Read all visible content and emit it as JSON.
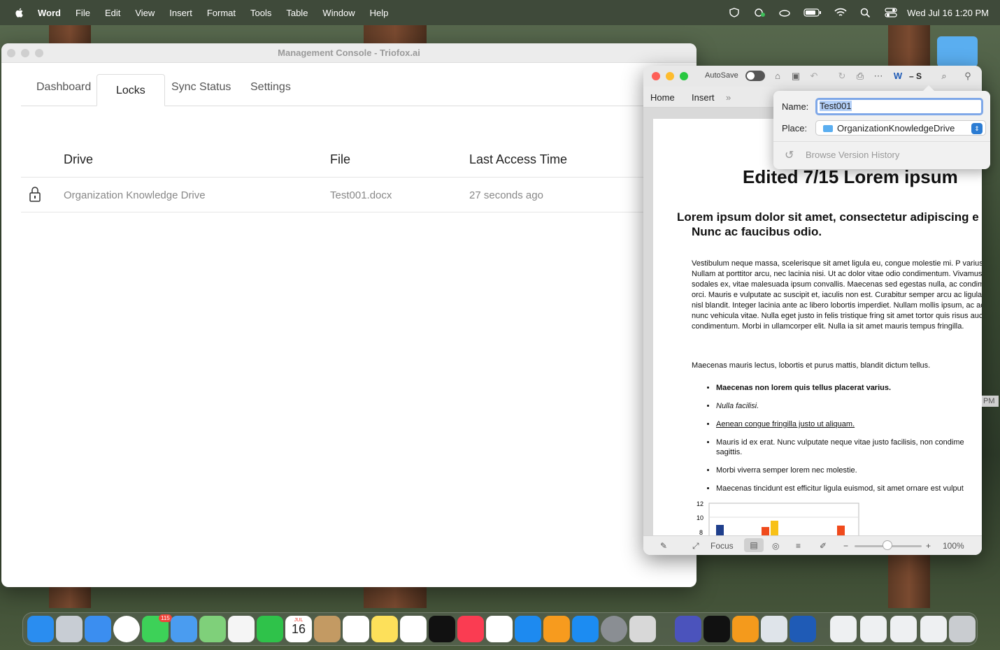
{
  "menubar": {
    "app": "Word",
    "items": [
      "File",
      "Edit",
      "View",
      "Insert",
      "Format",
      "Tools",
      "Table",
      "Window",
      "Help"
    ],
    "datetime": "Wed Jul 16  1:20 PM"
  },
  "console": {
    "title": "Management Console - Triofox.ai",
    "tabs": [
      "Dashboard",
      "Locks",
      "Sync Status",
      "Settings"
    ],
    "active_tab": "Locks",
    "columns": [
      "Drive",
      "File",
      "Last Access Time"
    ],
    "rows": [
      {
        "drive": "Organization Knowledge Drive",
        "file": "Test001.docx",
        "time": "27 seconds ago"
      }
    ]
  },
  "word": {
    "autosave_label": "AutoSave",
    "doc_name_short": "– S",
    "ribbon_tabs": [
      "Home",
      "Insert"
    ],
    "heading": "Edited 7/15 Lorem ipsum",
    "subheading_line1": "Lorem ipsum dolor sit amet, consectetur adipiscing e",
    "subheading_line2": "Nunc ac faucibus odio.",
    "para1": "Vestibulum neque massa, scelerisque sit amet ligula eu, congue molestie mi. P varius sem. Nullam at porttitor arcu, nec lacinia nisi. Ut ac dolor vitae odio condimentum. Vivamus dapibus sodales ex, vitae malesuada ipsum convallis. Maecenas sed egestas nulla, ac condimentum orci. Mauris e vulputate ac suscipit et, iaculis non est. Curabitur semper arcu ac ligula se luctus nisl blandit. Integer lacinia ante ac libero lobortis imperdiet. Nullam mollis ipsum, ac accumsan nunc vehicula vitae. Nulla eget justo in felis tristique fring sit amet tortor quis risus auctor condimentum. Morbi in ullamcorper elit. Nulla ia sit amet mauris tempus fringilla.",
    "para2": "Maecenas mauris lectus, lobortis et purus mattis, blandit dictum tellus.",
    "bullets": [
      "Maecenas non lorem quis tellus placerat varius.",
      "Nulla facilisi.",
      "Aenean congue fringilla justo ut aliquam.",
      "Mauris id ex erat. Nunc vulputate neque vitae justo facilisis, non condime",
      "Morbi viverra semper lorem nec molestie.",
      "Maecenas tincidunt est efficitur ligula euismod, sit amet ornare est vulput"
    ],
    "bullet4_cont": "sagittis.",
    "chart_ticks": [
      "12",
      "10",
      "8"
    ],
    "focus_label": "Focus",
    "zoom": "100%",
    "side_label": "PM"
  },
  "popover": {
    "name_label": "Name:",
    "name_value": "Test001",
    "place_label": "Place:",
    "place_value": "OrganizationKnowledgeDrive",
    "history": "Browse Version History"
  },
  "dock": {
    "messages_badge": "115",
    "calendar_month": "JUL",
    "calendar_day": "16"
  },
  "colors": {
    "accent": "#2b7cd3",
    "word_blue": "#1f5bb6"
  }
}
